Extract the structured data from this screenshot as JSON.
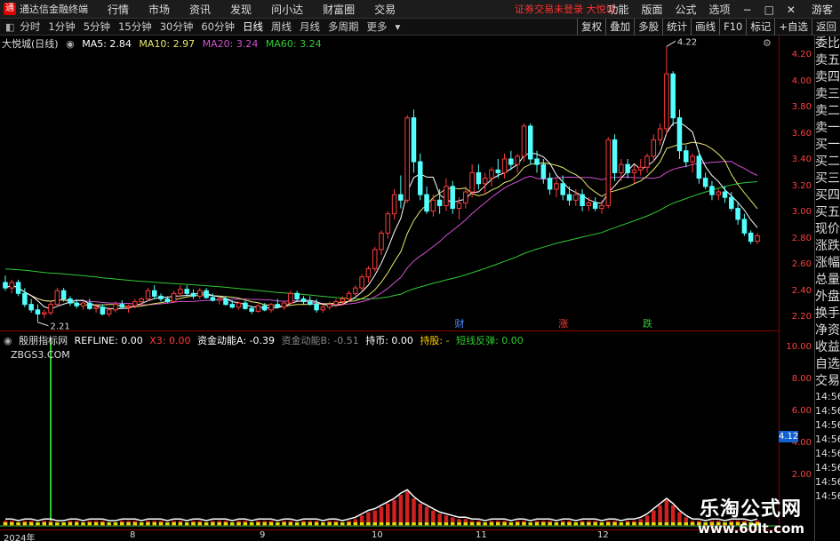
{
  "menubar": {
    "app_title": "通达信金融终端",
    "menus": [
      "行情",
      "市场",
      "资讯",
      "发现",
      "问小达",
      "财富圈",
      "交易"
    ],
    "notice": "证券交易未登录  大悦城",
    "right_items": [
      "功能",
      "版面",
      "公式",
      "选项",
      "游客"
    ],
    "window_buttons": [
      "−",
      "□",
      "✕"
    ]
  },
  "toolbar": {
    "periods": [
      "分时",
      "1分钟",
      "5分钟",
      "15分钟",
      "30分钟",
      "60分钟",
      "日线",
      "周线",
      "月线",
      "多周期",
      "更多"
    ],
    "active_period": "日线",
    "right_buttons": [
      "复权",
      "叠加",
      "多股",
      "统计",
      "画线",
      "F10",
      "标记",
      "+自选",
      "返回"
    ]
  },
  "main_legend": {
    "stock": "大悦城(日线)",
    "ma5": "MA5: 2.84",
    "ma10": "MA10: 2.97",
    "ma20": "MA20: 3.24",
    "ma60": "MA60: 3.24"
  },
  "price_axis": [
    "4.20",
    "4.00",
    "3.80",
    "3.60",
    "3.40",
    "3.20",
    "3.00",
    "2.80",
    "2.60",
    "2.40",
    "2.20"
  ],
  "annotations": {
    "high": "4.22",
    "low": "2.21",
    "markers": [
      "财",
      "涨",
      "跌"
    ]
  },
  "indicator_legend": {
    "name": "殷朋指标网",
    "refline": "REFLINE: 0.00",
    "x3": "X3: 0.00",
    "fundA": "资金动能A: -0.39",
    "fundB": "资金动能B: -0.51",
    "hold": "持币: 0.00",
    "holdshares": "持股: -",
    "rebound": "短线反弹: 0.00"
  },
  "indicator_site": "ZBGS3.COM",
  "indicator_axis": [
    "10.00",
    "8.00",
    "6.00",
    "4.00",
    "2.00"
  ],
  "indicator_current": "4.12",
  "time_axis": [
    "2024年",
    "8",
    "9",
    "10",
    "11",
    "12"
  ],
  "side_panel": {
    "rows": [
      "委比",
      "卖五",
      "卖四",
      "卖三",
      "卖二",
      "卖一",
      "买一",
      "买二",
      "买三",
      "买四",
      "买五",
      "现价",
      "涨跌",
      "涨幅",
      "总量",
      "外盘",
      "换手",
      "净资",
      "收益",
      "自选",
      "交易"
    ],
    "times": [
      "14:56",
      "14:56",
      "14:56",
      "14:56",
      "14:56",
      "14:56",
      "14:56",
      "14:56"
    ]
  },
  "watermark": {
    "title": "乐淘公式网",
    "url": "www.60lt.com"
  },
  "colors": {
    "up": "#ff3c3c",
    "down": "#54ffff",
    "ma5": "#ffffff",
    "ma10": "#e8e86c",
    "ma20": "#d050d0",
    "ma60": "#32c832"
  },
  "chart_data": {
    "type": "candlestick",
    "ohlc": [
      [
        2.5,
        2.55,
        2.44,
        2.46
      ],
      [
        2.46,
        2.52,
        2.42,
        2.5
      ],
      [
        2.5,
        2.52,
        2.4,
        2.42
      ],
      [
        2.42,
        2.46,
        2.32,
        2.34
      ],
      [
        2.34,
        2.38,
        2.28,
        2.3
      ],
      [
        2.3,
        2.34,
        2.21,
        2.27
      ],
      [
        2.27,
        2.3,
        2.24,
        2.28
      ],
      [
        2.28,
        2.36,
        2.26,
        2.34
      ],
      [
        2.34,
        2.46,
        2.32,
        2.44
      ],
      [
        2.44,
        2.46,
        2.36,
        2.38
      ],
      [
        2.38,
        2.4,
        2.33,
        2.35
      ],
      [
        2.35,
        2.38,
        2.31,
        2.33
      ],
      [
        2.33,
        2.36,
        2.3,
        2.35
      ],
      [
        2.35,
        2.38,
        2.3,
        2.31
      ],
      [
        2.31,
        2.34,
        2.28,
        2.32
      ],
      [
        2.32,
        2.34,
        2.26,
        2.27
      ],
      [
        2.27,
        2.32,
        2.25,
        2.3
      ],
      [
        2.3,
        2.36,
        2.28,
        2.34
      ],
      [
        2.34,
        2.37,
        2.31,
        2.32
      ],
      [
        2.32,
        2.34,
        2.28,
        2.33
      ],
      [
        2.33,
        2.38,
        2.31,
        2.36
      ],
      [
        2.36,
        2.39,
        2.33,
        2.38
      ],
      [
        2.38,
        2.46,
        2.36,
        2.44
      ],
      [
        2.44,
        2.48,
        2.38,
        2.4
      ],
      [
        2.4,
        2.42,
        2.36,
        2.38
      ],
      [
        2.38,
        2.4,
        2.35,
        2.36
      ],
      [
        2.36,
        2.44,
        2.35,
        2.42
      ],
      [
        2.42,
        2.48,
        2.4,
        2.45
      ],
      [
        2.45,
        2.48,
        2.4,
        2.42
      ],
      [
        2.42,
        2.45,
        2.38,
        2.4
      ],
      [
        2.4,
        2.46,
        2.38,
        2.44
      ],
      [
        2.44,
        2.46,
        2.38,
        2.39
      ],
      [
        2.39,
        2.42,
        2.36,
        2.37
      ],
      [
        2.37,
        2.4,
        2.34,
        2.38
      ],
      [
        2.38,
        2.4,
        2.33,
        2.34
      ],
      [
        2.34,
        2.37,
        2.31,
        2.32
      ],
      [
        2.32,
        2.36,
        2.3,
        2.35
      ],
      [
        2.35,
        2.37,
        2.3,
        2.31
      ],
      [
        2.31,
        2.33,
        2.27,
        2.29
      ],
      [
        2.29,
        2.34,
        2.28,
        2.33
      ],
      [
        2.33,
        2.35,
        2.29,
        2.3
      ],
      [
        2.3,
        2.35,
        2.28,
        2.34
      ],
      [
        2.34,
        2.38,
        2.31,
        2.32
      ],
      [
        2.32,
        2.36,
        2.3,
        2.35
      ],
      [
        2.35,
        2.44,
        2.34,
        2.42
      ],
      [
        2.42,
        2.44,
        2.36,
        2.38
      ],
      [
        2.38,
        2.4,
        2.34,
        2.36
      ],
      [
        2.36,
        2.4,
        2.33,
        2.34
      ],
      [
        2.34,
        2.38,
        2.28,
        2.3
      ],
      [
        2.3,
        2.34,
        2.28,
        2.32
      ],
      [
        2.32,
        2.36,
        2.3,
        2.34
      ],
      [
        2.34,
        2.38,
        2.32,
        2.36
      ],
      [
        2.36,
        2.4,
        2.33,
        2.38
      ],
      [
        2.38,
        2.44,
        2.36,
        2.42
      ],
      [
        2.42,
        2.48,
        2.4,
        2.46
      ],
      [
        2.46,
        2.56,
        2.44,
        2.54
      ],
      [
        2.54,
        2.62,
        2.5,
        2.6
      ],
      [
        2.6,
        2.76,
        2.58,
        2.74
      ],
      [
        2.74,
        2.88,
        2.7,
        2.86
      ],
      [
        2.86,
        3.02,
        2.82,
        3.0
      ],
      [
        3.0,
        3.18,
        2.96,
        3.14
      ],
      [
        3.14,
        3.28,
        3.04,
        3.1
      ],
      [
        3.1,
        3.72,
        3.08,
        3.7
      ],
      [
        3.7,
        3.76,
        3.3,
        3.38
      ],
      [
        3.38,
        3.44,
        3.1,
        3.14
      ],
      [
        3.14,
        3.2,
        3.0,
        3.02
      ],
      [
        3.02,
        3.14,
        2.98,
        3.1
      ],
      [
        3.1,
        3.18,
        3.0,
        3.06
      ],
      [
        3.06,
        3.26,
        3.02,
        3.2
      ],
      [
        3.2,
        3.24,
        3.0,
        3.04
      ],
      [
        3.04,
        3.12,
        2.96,
        3.08
      ],
      [
        3.08,
        3.2,
        3.04,
        3.16
      ],
      [
        3.16,
        3.36,
        3.12,
        3.3
      ],
      [
        3.3,
        3.36,
        3.18,
        3.22
      ],
      [
        3.22,
        3.3,
        3.14,
        3.26
      ],
      [
        3.26,
        3.34,
        3.2,
        3.32
      ],
      [
        3.32,
        3.4,
        3.26,
        3.3
      ],
      [
        3.3,
        3.44,
        3.26,
        3.4
      ],
      [
        3.4,
        3.46,
        3.32,
        3.36
      ],
      [
        3.36,
        3.44,
        3.3,
        3.42
      ],
      [
        3.42,
        3.66,
        3.38,
        3.64
      ],
      [
        3.64,
        3.66,
        3.36,
        3.4
      ],
      [
        3.4,
        3.46,
        3.3,
        3.36
      ],
      [
        3.36,
        3.4,
        3.22,
        3.26
      ],
      [
        3.26,
        3.3,
        3.14,
        3.18
      ],
      [
        3.18,
        3.26,
        3.12,
        3.22
      ],
      [
        3.22,
        3.28,
        3.1,
        3.14
      ],
      [
        3.14,
        3.2,
        3.06,
        3.1
      ],
      [
        3.1,
        3.18,
        3.06,
        3.14
      ],
      [
        3.14,
        3.18,
        3.02,
        3.06
      ],
      [
        3.06,
        3.12,
        3.02,
        3.08
      ],
      [
        3.08,
        3.12,
        3.02,
        3.04
      ],
      [
        3.04,
        3.1,
        3.0,
        3.06
      ],
      [
        3.06,
        3.56,
        3.04,
        3.54
      ],
      [
        3.54,
        3.58,
        3.24,
        3.3
      ],
      [
        3.3,
        3.4,
        3.24,
        3.36
      ],
      [
        3.36,
        3.4,
        3.26,
        3.3
      ],
      [
        3.3,
        3.36,
        3.22,
        3.32
      ],
      [
        3.32,
        3.4,
        3.28,
        3.34
      ],
      [
        3.34,
        3.44,
        3.3,
        3.42
      ],
      [
        3.42,
        3.58,
        3.38,
        3.54
      ],
      [
        3.54,
        3.66,
        3.5,
        3.62
      ],
      [
        3.62,
        4.22,
        3.58,
        4.02
      ],
      [
        4.02,
        4.04,
        3.64,
        3.7
      ],
      [
        3.7,
        3.76,
        3.4,
        3.46
      ],
      [
        3.46,
        3.5,
        3.34,
        3.38
      ],
      [
        3.38,
        3.44,
        3.3,
        3.42
      ],
      [
        3.42,
        3.46,
        3.22,
        3.26
      ],
      [
        3.26,
        3.3,
        3.18,
        3.2
      ],
      [
        3.2,
        3.24,
        3.1,
        3.14
      ],
      [
        3.14,
        3.18,
        3.1,
        3.16
      ],
      [
        3.16,
        3.2,
        3.08,
        3.12
      ],
      [
        3.12,
        3.16,
        3.02,
        3.04
      ],
      [
        3.04,
        3.08,
        2.92,
        2.96
      ],
      [
        2.96,
        3.0,
        2.84,
        2.86
      ],
      [
        2.86,
        2.88,
        2.78,
        2.8
      ],
      [
        2.8,
        2.86,
        2.78,
        2.84
      ]
    ],
    "ma60_start": 2.6,
    "ylim": [
      2.15,
      4.3
    ],
    "indicator": {
      "type": "bar",
      "ylim": [
        0,
        11
      ],
      "values": [
        0.3,
        0.3,
        0.2,
        0.3,
        0.3,
        0.2,
        0.3,
        0.3,
        0.2,
        0.2,
        0.3,
        0.3,
        0.2,
        0.3,
        0.3,
        0.3,
        0.2,
        0.2,
        0.3,
        0.3,
        0.3,
        0.2,
        0.3,
        0.3,
        0.3,
        0.2,
        0.3,
        0.3,
        0.2,
        0.3,
        0.3,
        0.2,
        0.3,
        0.3,
        0.3,
        0.2,
        0.3,
        0.3,
        0.2,
        0.3,
        0.3,
        0.3,
        0.2,
        0.3,
        0.3,
        0.2,
        0.3,
        0.3,
        0.3,
        0.2,
        0.3,
        0.3,
        0.2,
        0.3,
        0.4,
        0.6,
        0.8,
        0.9,
        1.1,
        1.3,
        1.5,
        1.8,
        2.0,
        1.6,
        1.3,
        1.1,
        0.9,
        0.7,
        0.6,
        0.5,
        0.4,
        0.4,
        0.3,
        0.3,
        0.2,
        0.3,
        0.3,
        0.3,
        0.2,
        0.3,
        0.3,
        0.2,
        0.3,
        0.3,
        0.3,
        0.2,
        0.3,
        0.3,
        0.2,
        0.3,
        0.3,
        0.3,
        0.2,
        0.3,
        0.3,
        0.2,
        0.3,
        0.3,
        0.4,
        0.6,
        0.9,
        1.2,
        1.5,
        1.2,
        0.8,
        0.5,
        0.3,
        0.3,
        0.2,
        0.3,
        0.3,
        0.2,
        0.3,
        0.3,
        0.3,
        0.2,
        0.3
      ],
      "spike_index": 7,
      "spike_value": 10.9
    }
  }
}
